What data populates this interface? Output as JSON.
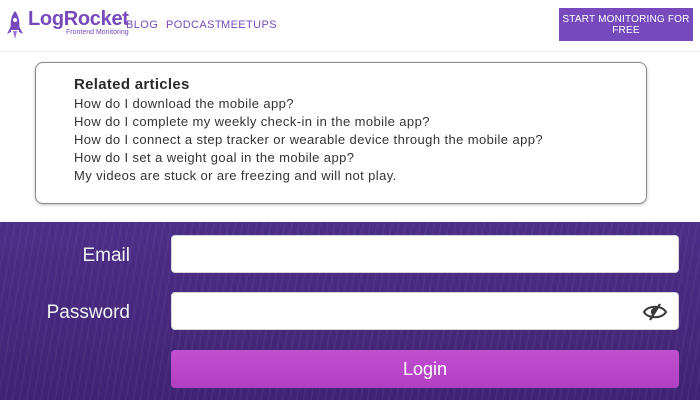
{
  "header": {
    "logo": {
      "name": "LogRocket",
      "tagline": "Frontend Monitoring",
      "icon": "rocket-icon",
      "color": "#764abc"
    },
    "nav_links": [
      "BLOG",
      "PODCAST",
      "MEETUPS"
    ],
    "cta_label": "START MONITORING FOR FREE"
  },
  "related": {
    "title": "Related articles",
    "articles": [
      "How do I download the mobile app?",
      "How do I complete my weekly check-in in the mobile app?",
      "How do I connect a step tracker or wearable device through the mobile app?",
      "How do I set a weight goal in the mobile app?",
      "My videos are stuck or are freezing and will not play."
    ]
  },
  "login": {
    "email_label": "Email",
    "email_value": "",
    "password_label": "Password",
    "password_value": "",
    "password_toggle_icon": "eye-slash-icon",
    "submit_label": "Login",
    "background_color": "#47297f",
    "button_color": "#b845c8"
  }
}
